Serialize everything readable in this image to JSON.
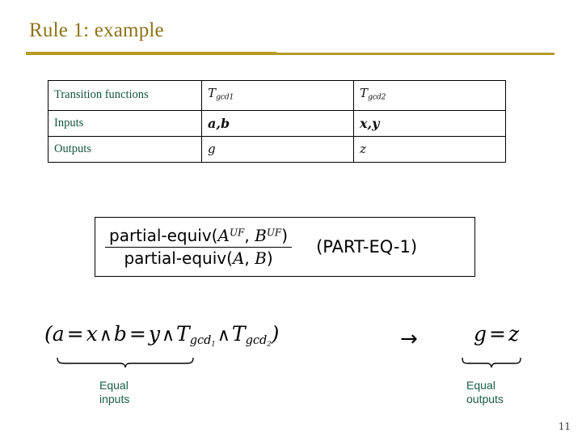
{
  "slide": {
    "title": "Rule 1: example",
    "page_number": "11",
    "accent_color": "#b39a24",
    "title_color": "#8c7318",
    "label_color": "#14543c",
    "caption_color": "#1b5e45"
  },
  "table": {
    "rows": [
      {
        "label": "Transition functions",
        "value1_base": "T",
        "value1_sub": "gcd1",
        "value2_base": "T",
        "value2_sub": "gcd2",
        "style": "subscripted"
      },
      {
        "label": "Inputs",
        "value1": "a,b",
        "value2": "x,y",
        "style": "bold"
      },
      {
        "label": "Outputs",
        "value1": "g",
        "value2": "z",
        "style": "plain"
      }
    ]
  },
  "rule_box": {
    "numerator_prefix": "partial-equiv(",
    "numerator_var1": "A",
    "numerator_sup1": "UF",
    "numerator_sep": ", ",
    "numerator_var2": "B",
    "numerator_sup2": "UF",
    "numerator_suffix": ")",
    "denominator_prefix": "partial-equiv(",
    "denominator_var1": "A",
    "denominator_sep": ", ",
    "denominator_var2": "B",
    "denominator_suffix": ")",
    "rule_name": "(PART-EQ-1)"
  },
  "formula": {
    "antecedent": {
      "open_paren": "(",
      "a": "a",
      "eq1": "=",
      "x": "x",
      "and1": "∧",
      "b": "b",
      "eq2": "=",
      "y": "y",
      "and2": "∧",
      "t1_base": "T",
      "t1_sub": "gcd",
      "t1_index": "1",
      "and3": "∧",
      "t2_base": "T",
      "t2_sub": "gcd",
      "t2_index": "2",
      "close_paren": ")"
    },
    "arrow": "→",
    "consequent": {
      "g": "g",
      "eq": "=",
      "z": "z"
    },
    "caption_left": "Equal\ninputs",
    "caption_right": "Equal\noutputs"
  }
}
